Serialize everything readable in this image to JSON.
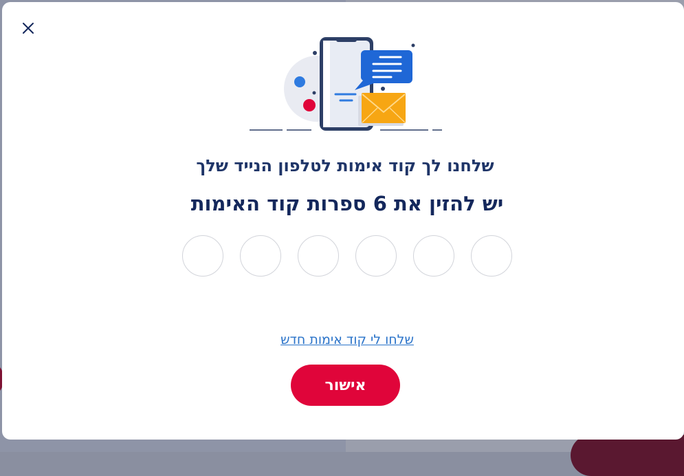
{
  "modal": {
    "close_icon": "close-icon",
    "illustration": "phone-message-envelope-illustration",
    "title": "שלחנו לך קוד אימות לטלפון הנייד שלך",
    "subtitle": "יש להזין את 6 ספרות קוד האימות",
    "code_inputs": [
      "",
      "",
      "",
      "",
      "",
      ""
    ],
    "resend_link": "שלחו לי קוד אימות חדש",
    "confirm_button": "אישור"
  },
  "colors": {
    "accent": "#e0053a",
    "title": "#1f3568",
    "link": "#2a73c9"
  }
}
